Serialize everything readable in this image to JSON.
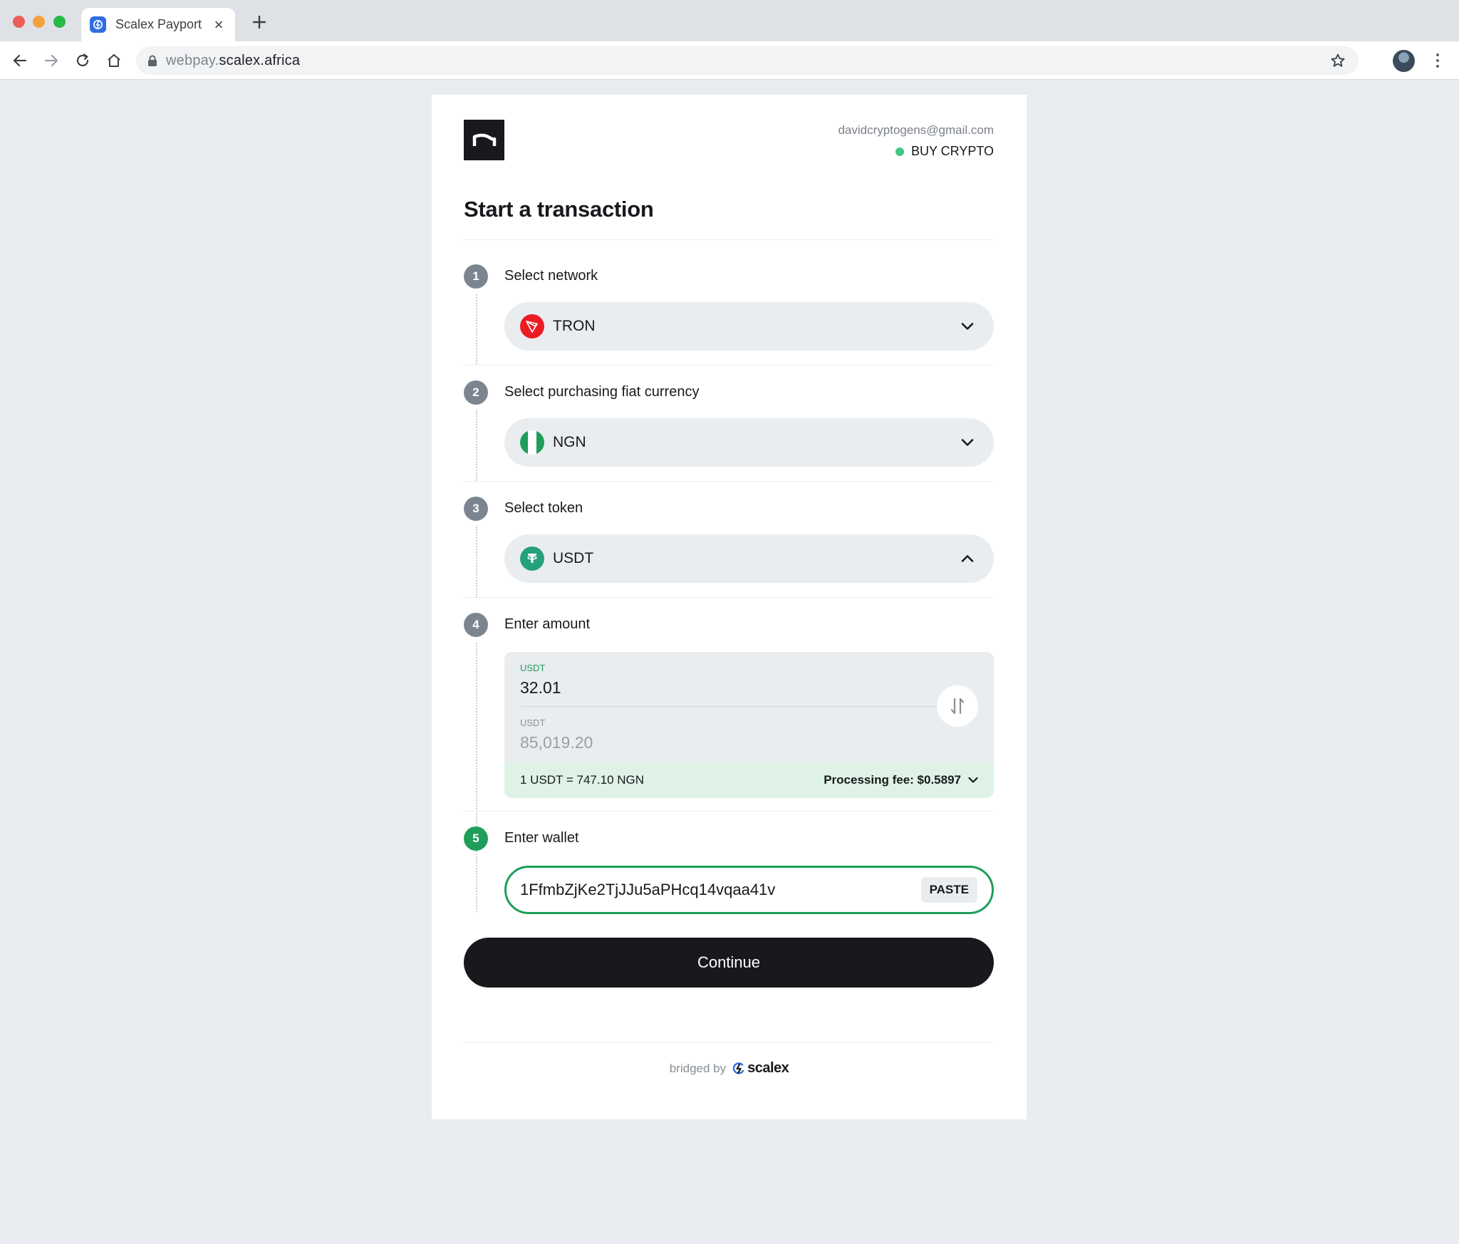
{
  "browser": {
    "tab_title": "Scalex Payport",
    "tab_close": "×",
    "url_subdomain": "webpay.",
    "url_domain": "scalex.africa"
  },
  "header": {
    "email": "davidcryptogens@gmail.com",
    "mode": "BUY CRYPTO",
    "mode_color": "#44c584"
  },
  "title": "Start a transaction",
  "steps": [
    {
      "number": "1",
      "label": "Select network",
      "value": "TRON",
      "icon": "tron-icon"
    },
    {
      "number": "2",
      "label": "Select purchasing fiat currency",
      "value": "NGN",
      "icon": "nigeria-flag-icon"
    },
    {
      "number": "3",
      "label": "Select token",
      "value": "USDT",
      "icon": "tether-icon"
    },
    {
      "number": "4",
      "label": "Enter amount"
    },
    {
      "number": "5",
      "label": "Enter wallet"
    }
  ],
  "amount": {
    "top_currency": "USDT",
    "top_value": "32.01",
    "bottom_currency": "USDT",
    "bottom_value": "85,019.20",
    "rate": "1 USDT = 747.10 NGN",
    "fee": "Processing fee: $0.5897"
  },
  "wallet": {
    "address": "1FfmbZjKe2TjJJu5aPHcq14vqaa41v",
    "paste_label": "PASTE"
  },
  "continue_label": "Continue",
  "footer": {
    "bridged_by": "bridged by",
    "brand": "scalex"
  },
  "colors": {
    "accent_green": "#1e9e5a",
    "primary_button": "#17191c",
    "rate_bar": "#def3e6"
  }
}
